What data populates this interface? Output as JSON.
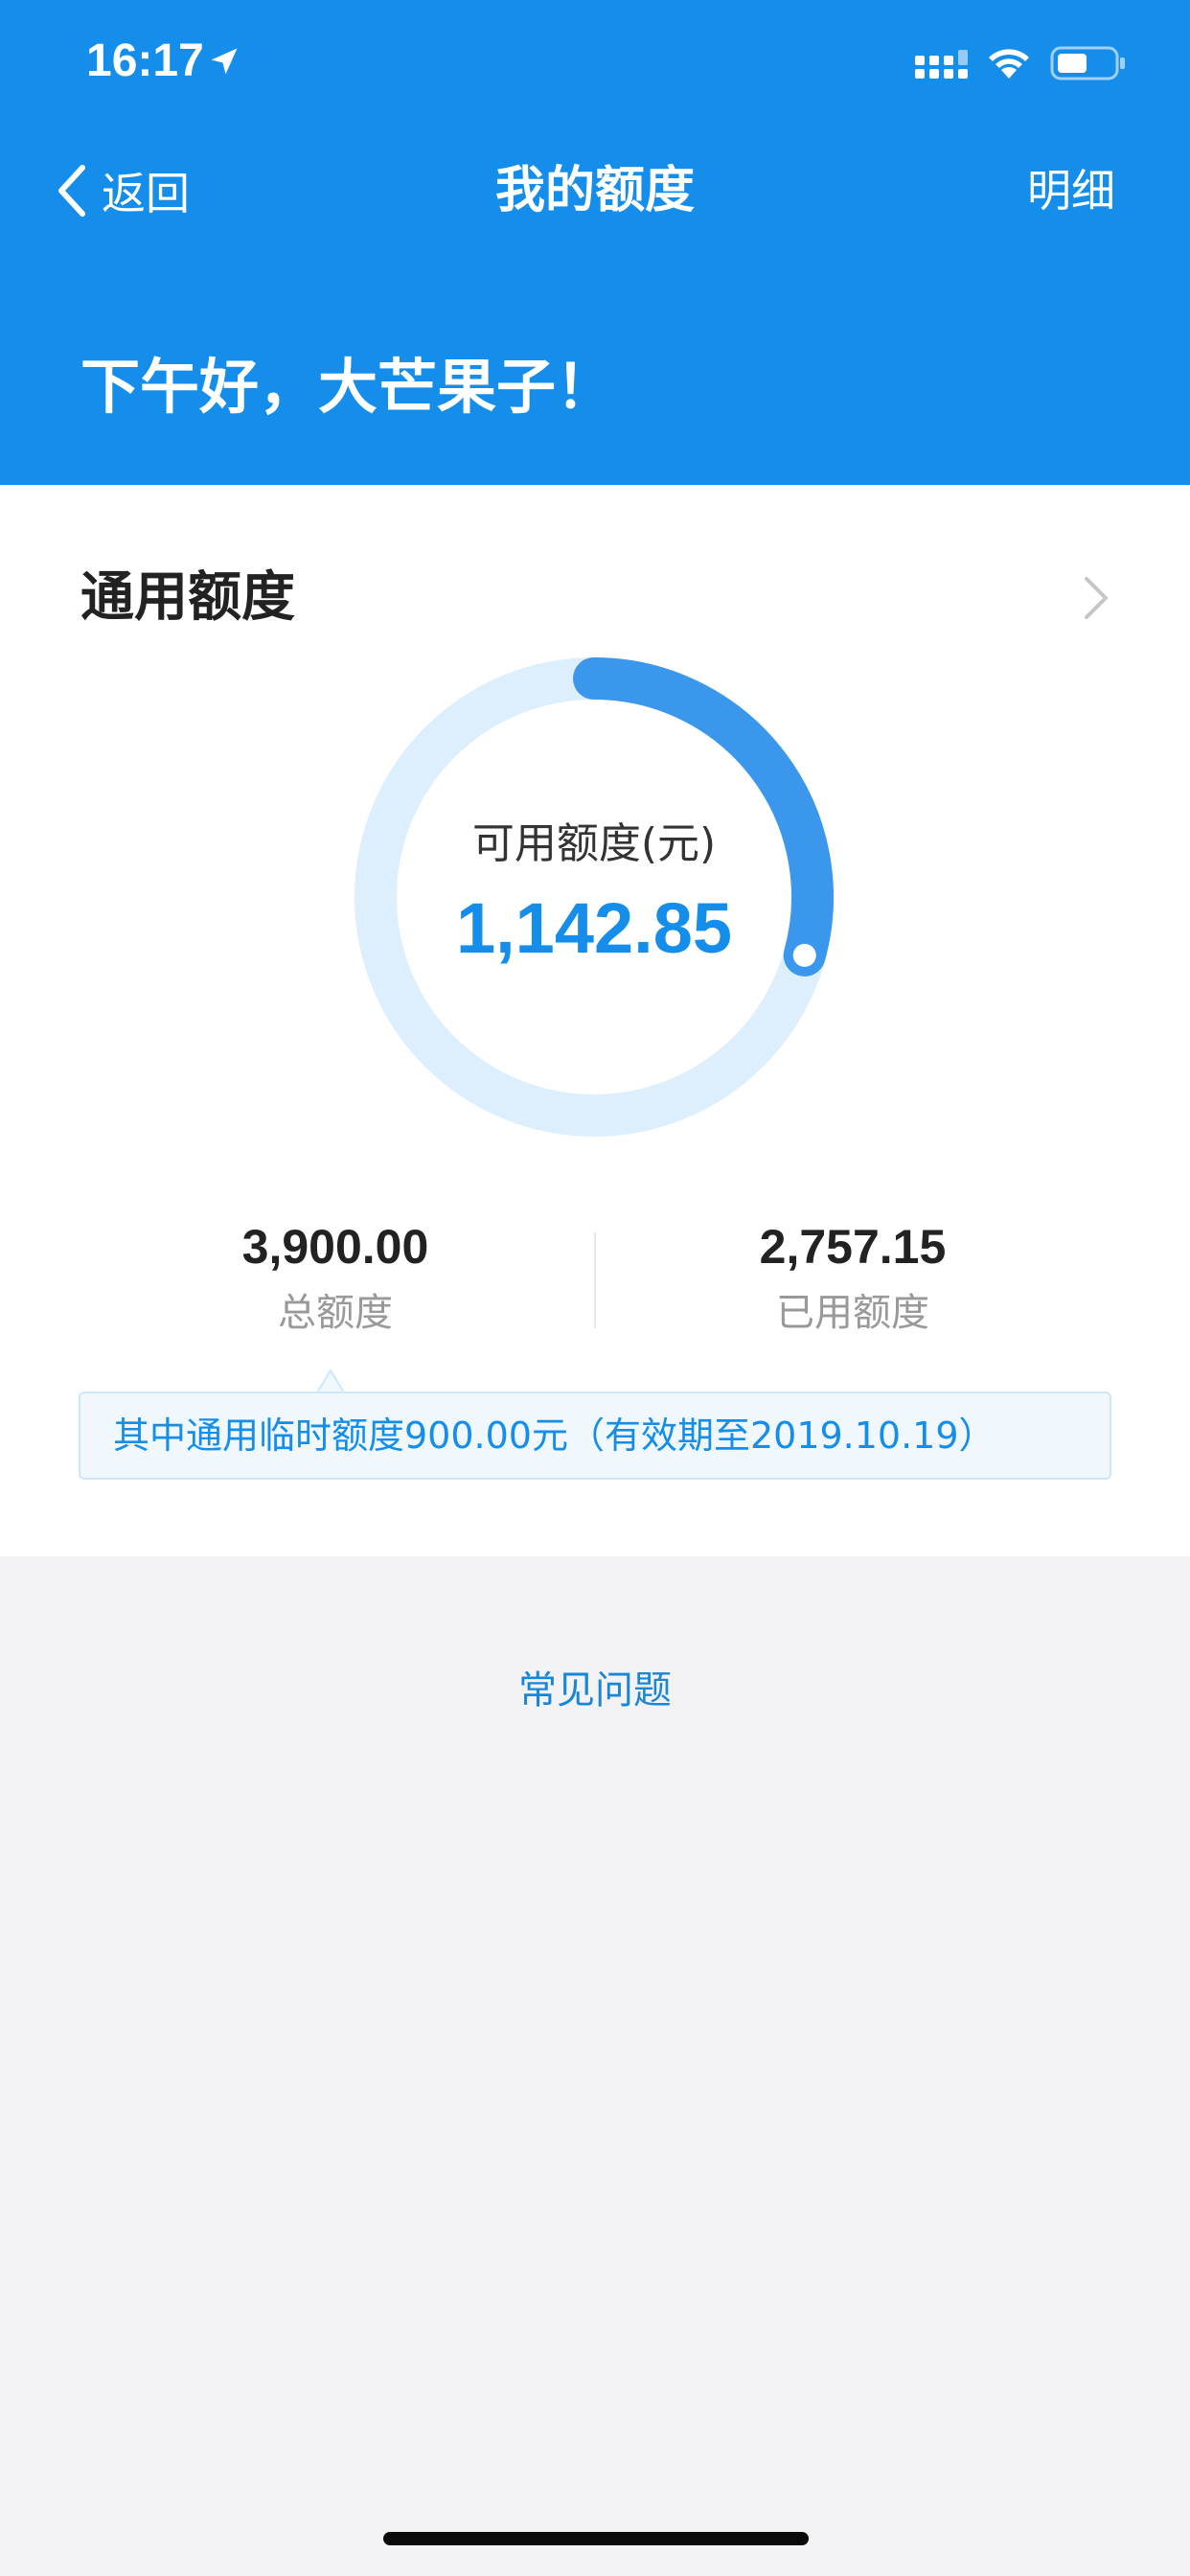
{
  "status_bar": {
    "time": "16:17",
    "icons": [
      "location-arrow-icon",
      "signal-icon",
      "wifi-icon",
      "battery-icon"
    ]
  },
  "nav": {
    "back_label": "返回",
    "title": "我的额度",
    "right_action": "明细"
  },
  "greeting": "下午好，大芒果子！",
  "section": {
    "title": "通用额度"
  },
  "ring": {
    "label": "可用额度(元)",
    "value": "1,142.85",
    "used_fraction": 0.293
  },
  "stats": {
    "total_value": "3,900.00",
    "total_label": "总额度",
    "used_value": "2,757.15",
    "used_label": "已用额度"
  },
  "notice": "其中通用临时额度900.00元（有效期至2019.10.19）",
  "faq_label": "常见问题",
  "colors": {
    "primary": "#148deb",
    "ring_track": "#ddeffc",
    "ring_progress": "#3a97ec",
    "page_bg": "#f3f3f6"
  }
}
